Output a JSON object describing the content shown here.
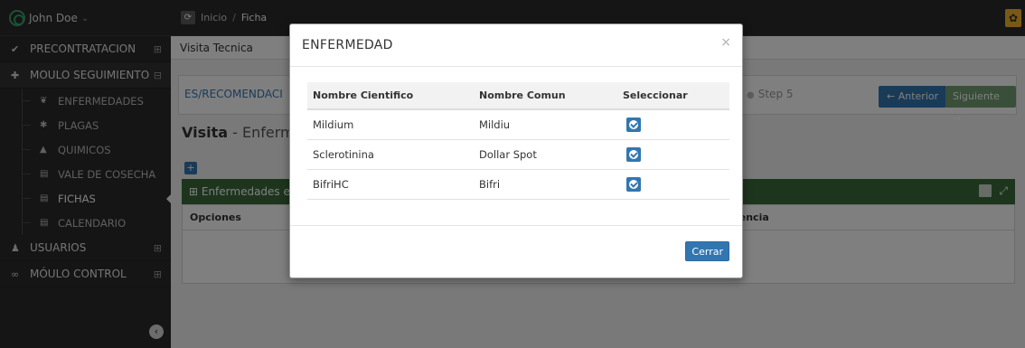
{
  "topbar": {
    "user_name": "John Doe",
    "user_caret": "⌄",
    "breadcrumb": [
      "Inicio",
      "Ficha"
    ],
    "breadcrumb_sep": "/"
  },
  "sidebar": {
    "items": [
      {
        "label": "PRECONTRATACION",
        "icon": "check-icon",
        "toggle": "⊞"
      },
      {
        "label": "MOULO SEGUIMIENTO",
        "icon": "plus-icon",
        "toggle": "⊟"
      },
      {
        "label": "ENFERMEDADES",
        "icon": "leaf-icon"
      },
      {
        "label": "PLAGAS",
        "icon": "bug-icon"
      },
      {
        "label": "QUIMICOS",
        "icon": "flask-icon"
      },
      {
        "label": "VALE DE COSECHA",
        "icon": "list-icon"
      },
      {
        "label": "FICHAS",
        "icon": "list-icon"
      },
      {
        "label": "CALENDARIO",
        "icon": "list-icon"
      },
      {
        "label": "USUARIOS",
        "icon": "users-icon",
        "toggle": "⊞"
      },
      {
        "label": "MÓULO CONTROL",
        "icon": "infinity-icon",
        "toggle": "⊞"
      }
    ],
    "active_item": "FICHAS"
  },
  "content": {
    "header": "Visita Tecnica",
    "step_left": "ES/RECOMENDACI",
    "step5": "Step 5",
    "btn_anterior": "← Anterior",
    "btn_siguiente": "Siguiente →",
    "title_bold": "Visita",
    "title_rest": " - Enferme",
    "widget_title": "⊞ Enfermedades en",
    "col_opciones": "Opciones",
    "col_frecuencia": "lencia"
  },
  "modal": {
    "title": "ENFERMEDAD",
    "close": "×",
    "columns": [
      "Nombre Cientifico",
      "Nombre Comun",
      "Seleccionar"
    ],
    "rows": [
      {
        "cientifico": "Mildium",
        "comun": "Mildiu"
      },
      {
        "cientifico": "Sclerotinina",
        "comun": "Dollar Spot"
      },
      {
        "cientifico": "BifriHC",
        "comun": "Bifri"
      }
    ],
    "close_button": "Cerrar"
  },
  "colors": {
    "primary": "#3276b1",
    "success": "#739e73",
    "widget_header": "#3a6b3a",
    "sidebar_bg": "#2b2b2b"
  }
}
